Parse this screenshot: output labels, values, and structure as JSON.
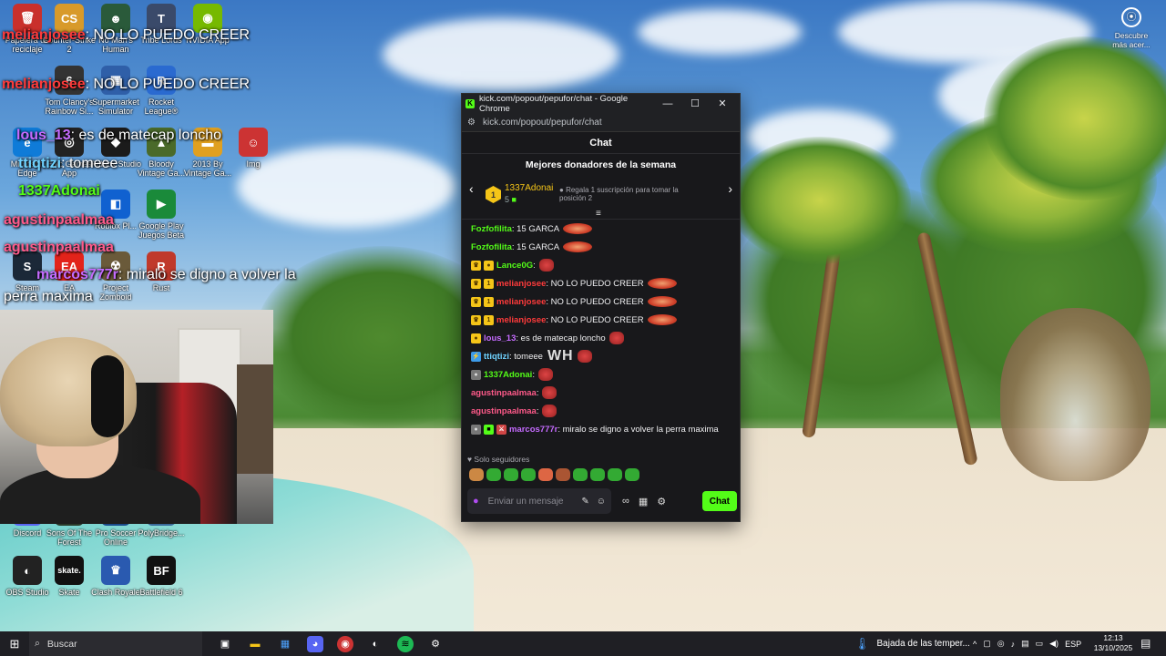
{
  "desktop": {
    "icons": [
      {
        "label": "Papelera de reciclaje",
        "color": "#c9302c",
        "glyph": "🗑"
      },
      {
        "label": "Counter-Strike 2",
        "color": "#d89a2a",
        "glyph": "CS"
      },
      {
        "label": "No Man's Human",
        "color": "#2a5a3a",
        "glyph": "☻"
      },
      {
        "label": "Tribe Lords",
        "color": "#3a4a6a",
        "glyph": "T"
      },
      {
        "label": "NVIDIA App",
        "color": "#76b900",
        "glyph": "◉"
      },
      {
        "label": "Tom Clancy's Rainbow Si...",
        "color": "#333",
        "glyph": "6"
      },
      {
        "label": "Supermarket Simulator",
        "color": "#2f5fa8",
        "glyph": "▦"
      },
      {
        "label": "Rocket League®",
        "color": "#2a6ad0",
        "glyph": "R"
      },
      {
        "label": "Microsoft Edge",
        "color": "#0f7bd8",
        "glyph": "e"
      },
      {
        "label": "Epic Games App",
        "color": "#222",
        "glyph": "◎"
      },
      {
        "label": "Roblox Studio",
        "color": "#1b1b1b",
        "glyph": "◆"
      },
      {
        "label": "Bloody Vintage Ga...",
        "color": "#4a6a2a",
        "glyph": "▲"
      },
      {
        "label": "2013 By Vintage Ga...",
        "color": "#e0a020",
        "glyph": "▬"
      },
      {
        "label": "Img",
        "color": "#c33",
        "glyph": "☺"
      },
      {
        "label": "Steam",
        "color": "#1b2838",
        "glyph": "S"
      },
      {
        "label": "EA",
        "color": "#e2231a",
        "glyph": "EA"
      },
      {
        "label": "Project Zomboid",
        "color": "#6a5a3a",
        "glyph": "☢"
      },
      {
        "label": "Rust",
        "color": "#c0392b",
        "glyph": "R"
      },
      {
        "label": "Google Play Juegos Beta",
        "color": "#1a8a3a",
        "glyph": "▶"
      },
      {
        "label": "Roblox Pl...",
        "color": "#1061d0",
        "glyph": "◧"
      },
      {
        "label": "Discord",
        "color": "#5865f2",
        "glyph": "D"
      },
      {
        "label": "Sons Of The Forest",
        "color": "#2a3a2a",
        "glyph": "F"
      },
      {
        "label": "Pro Soccer Online",
        "color": "#1a4a8a",
        "glyph": "⚽"
      },
      {
        "label": "PolyBridge...",
        "color": "#3a6a9a",
        "glyph": "P"
      },
      {
        "label": "OBS Studio",
        "color": "#222",
        "glyph": "◐"
      },
      {
        "label": "Skate",
        "color": "#111",
        "glyph": "skate."
      },
      {
        "label": "Clash Royale",
        "color": "#2a5ab0",
        "glyph": "♛"
      },
      {
        "label": "Battlefield 6",
        "color": "#111",
        "glyph": "BF"
      }
    ],
    "overlay_chat": [
      {
        "user": "melianjosee",
        "text": ": NO LO PUEDO CREER",
        "color": "#ff3b3b"
      },
      {
        "user": "melianjosee",
        "text": ": NO LO PUEDO CREER",
        "color": "#ff3b3b"
      },
      {
        "user": "lous_13",
        "text": ": es de matecap loncho",
        "color": "#c56bff"
      },
      {
        "user": "ttiqtizi",
        "text": ": tomeee",
        "color": "#6fd3ff"
      },
      {
        "user": "1337Adonai",
        "text": "",
        "color": "#53fc18"
      },
      {
        "user": "agustinpaalmaa",
        "text": "",
        "color": "#ff5a8a"
      },
      {
        "user": "agustinpaalmaa",
        "text": "",
        "color": "#ff5a8a"
      },
      {
        "user": "marcos777r",
        "text": ": miralo se digno a volver la",
        "color": "#c56bff"
      },
      {
        "user": "",
        "text": "perra maxima",
        "color": "#fff"
      }
    ],
    "discover": {
      "line1": "Descubre",
      "line2": "más acer..."
    }
  },
  "chrome": {
    "title": "kick.com/popout/pepufor/chat - Google Chrome",
    "url": "kick.com/popout/pepufor/chat",
    "minimize": "—",
    "maximize": "☐",
    "close": "✕"
  },
  "chat": {
    "header": "Chat",
    "donors": {
      "title": "Mejores donadores de la semana",
      "rank": "1",
      "name": "1337Adonai",
      "count": "5",
      "gift_text": "Regala 1 suscripción para tomar la posición 2"
    },
    "messages": [
      {
        "badges": [],
        "user": "Fozfofilita",
        "color": "#53fc18",
        "text": ": 15 GARCA",
        "emote": "big"
      },
      {
        "badges": [],
        "user": "Fozfofilita",
        "color": "#53fc18",
        "text": ": 15 GARCA",
        "emote": "big"
      },
      {
        "badges": [
          "crown",
          "sub"
        ],
        "user": "Lance0G",
        "color": "#53fc18",
        "text": ":",
        "emote": "small"
      },
      {
        "badges": [
          "crown",
          "sub1"
        ],
        "user": "melianjosee",
        "color": "#ff3b3b",
        "text": ": NO LO PUEDO CREER",
        "emote": "big"
      },
      {
        "badges": [
          "crown",
          "sub1"
        ],
        "user": "melianjosee",
        "color": "#ff3b3b",
        "text": ": NO LO PUEDO CREER",
        "emote": "big"
      },
      {
        "badges": [
          "crown",
          "sub1"
        ],
        "user": "melianjosee",
        "color": "#ff3b3b",
        "text": ": NO LO PUEDO CREER",
        "emote": "big"
      },
      {
        "badges": [
          "sub"
        ],
        "user": "lous_13",
        "color": "#c56bff",
        "text": ": es de matecap loncho",
        "emote": "small"
      },
      {
        "badges": [
          "bot"
        ],
        "user": "ttiqtizi",
        "color": "#6fd3ff",
        "text": ": tomeee",
        "emote": "wh"
      },
      {
        "badges": [
          "gray"
        ],
        "user": "1337Adonai",
        "color": "#53fc18",
        "text": ":",
        "emote": "small"
      },
      {
        "badges": [],
        "user": "agustinpaalmaa",
        "color": "#ff5a8a",
        "text": ":",
        "emote": "small"
      },
      {
        "badges": [],
        "user": "agustinpaalmaa",
        "color": "#ff5a8a",
        "text": ":",
        "emote": "small"
      },
      {
        "badges": [
          "gray",
          "green",
          "red"
        ],
        "user": "marcos777r",
        "color": "#c56bff",
        "text": ": miralo se digno a volver la perra maxima",
        "emote": "none"
      }
    ],
    "followers_only": "Solo seguidores",
    "input_placeholder": "Enviar un mensaje",
    "send_label": "Chat",
    "wh_text": "WH"
  },
  "taskbar": {
    "search_placeholder": "Buscar",
    "weather": "Bajada de las temper...",
    "lang": "ESP",
    "time": "12:13",
    "date": "13/10/2025"
  }
}
